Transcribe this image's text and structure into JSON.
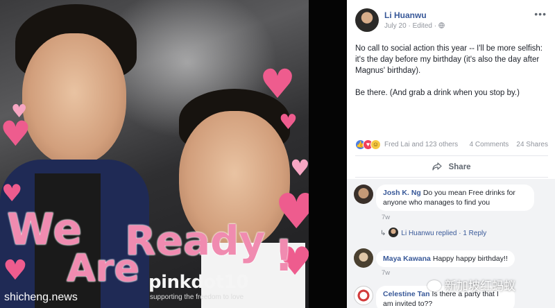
{
  "photo": {
    "overlay_line1": "We",
    "overlay_line2": "Are",
    "overlay_word": "Ready",
    "overlay_exclaim": "!",
    "logo_text": "pinkdot10",
    "tagline": "supporting the freedom to love",
    "watermark_site": "shicheng.news"
  },
  "post": {
    "author": "Li Huanwu",
    "date": "July 20",
    "edited": "Edited",
    "separator": "·",
    "audience_icon": "globe-icon",
    "more_icon": "more-dots-icon",
    "more_label": "•••",
    "paragraph1": "No call to social action this year -- I'll be more selfish: it's the day before my birthday (it's also the day after Magnus' birthday).",
    "paragraph2": "Be there. (And grab a drink when you stop by.)"
  },
  "reactions": {
    "icons": [
      "like-icon",
      "love-icon",
      "haha-icon"
    ],
    "names": "Fred Lai and 123 others",
    "comments": "4 Comments",
    "shares": "24 Shares"
  },
  "actions": {
    "share_label": "Share",
    "share_icon": "share-arrow-icon"
  },
  "comments": [
    {
      "name": "Josh K. Ng",
      "text": "Do you mean Free drinks for anyone who manages to find you",
      "time": "7w"
    },
    {
      "name": "Maya Kawana",
      "text": "Happy happy birthday!!",
      "time": "7w"
    },
    {
      "name": "Celestine Tan",
      "text": "Is there a party that I am invited to??",
      "time": ""
    }
  ],
  "reply": {
    "text": "Li Huanwu replied · 1 Reply"
  },
  "watermark_wechat": "新加坡红蚂蚁",
  "colors": {
    "link_blue": "#385898",
    "meta_gray": "#90949c",
    "comment_bg": "#f2f3f5",
    "overlay_pink": "#f08bb0",
    "heart_pink": "#ee5c8e"
  }
}
